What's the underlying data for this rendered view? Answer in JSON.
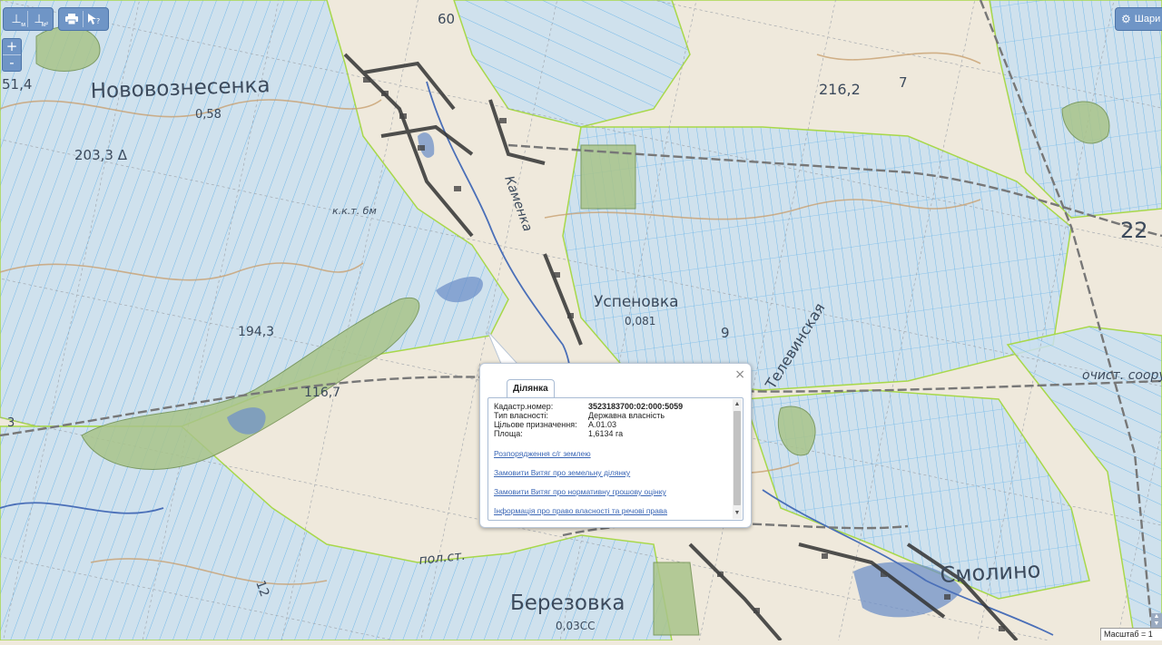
{
  "toolbar": {
    "measure_line_label": "м",
    "measure_area_label": "м²",
    "print_icon": "printer-icon",
    "identify_icon": "cursor-help-icon"
  },
  "zoom": {
    "in": "+",
    "out": "-"
  },
  "layers": {
    "label": "Шари",
    "icon": "gear-icon"
  },
  "map": {
    "labels": [
      {
        "text": "Нововознесенка",
        "kind": "settlement"
      },
      {
        "text": "0,58",
        "kind": "small"
      },
      {
        "text": "203,3 Δ",
        "kind": "height"
      },
      {
        "text": "Успеновка",
        "kind": "settlement"
      },
      {
        "text": "0,081",
        "kind": "small"
      },
      {
        "text": "Березовка",
        "kind": "settlement"
      },
      {
        "text": "0,03СС",
        "kind": "small"
      },
      {
        "text": "Смолино",
        "kind": "settlement"
      },
      {
        "text": "Телевинская",
        "kind": "river"
      },
      {
        "text": "пол.ст.",
        "kind": "small"
      },
      {
        "text": "очист. соору",
        "kind": "small"
      },
      {
        "text": "194,3",
        "kind": "height"
      },
      {
        "text": "116,7",
        "kind": "height"
      },
      {
        "text": "216,2",
        "kind": "height"
      },
      {
        "text": "22",
        "kind": "height"
      },
      {
        "text": "51,4",
        "kind": "height"
      },
      {
        "text": "60",
        "kind": "small"
      },
      {
        "text": "Каменка",
        "kind": "river"
      },
      {
        "text": "к.к.т. бм",
        "kind": "small"
      },
      {
        "text": "7",
        "kind": "small"
      },
      {
        "text": "9",
        "kind": "small"
      },
      {
        "text": "12",
        "kind": "small"
      },
      {
        "text": "3",
        "kind": "small"
      }
    ]
  },
  "popup": {
    "tab_label": "Ділянка",
    "close_label": "×",
    "fields": [
      {
        "key": "Кадастр.номер:",
        "value": "3523183700:02:000:5059"
      },
      {
        "key": "Тип власності:",
        "value": "Державна власність"
      },
      {
        "key": "Цільове призначення:",
        "value": "А.01.03"
      },
      {
        "key": "Площа:",
        "value": "1,6134 га"
      }
    ],
    "links": [
      "Розпорядження с/г землею",
      "Замовити Витяг про земельну ділянку",
      "Замовити Витяг про нормативну грошову оцінку",
      "Інформація про право власності та речові права"
    ]
  },
  "scale": {
    "label": "Масштаб = 1"
  },
  "colors": {
    "parcel_fill": "#c8dff0",
    "parcel_stroke": "#5fb0e8",
    "boundary": "#a8d84a",
    "accent": "#6f95c6"
  }
}
